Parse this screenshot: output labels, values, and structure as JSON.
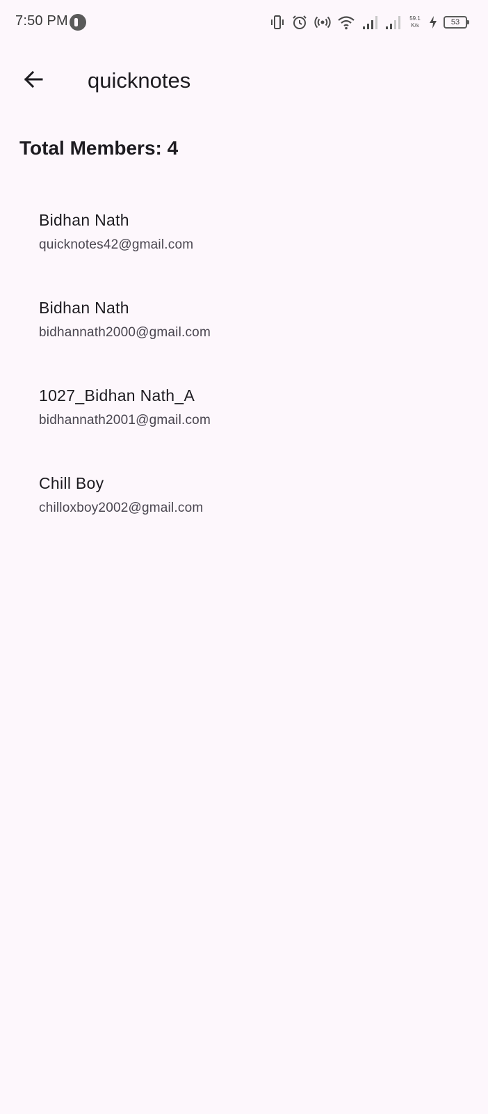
{
  "status_bar": {
    "time": "7:50 PM",
    "net_speed_value": "59.1",
    "net_speed_unit": "K/s",
    "battery_level": "53",
    "icons": [
      "app-notification-icon",
      "vibrate-icon",
      "alarm-icon",
      "hotspot-icon",
      "wifi-icon",
      "signal-icon",
      "signal-icon-2",
      "charging-icon",
      "battery-icon"
    ]
  },
  "app_bar": {
    "back_icon": "arrow-back-icon",
    "title": "quicknotes"
  },
  "summary": {
    "total_members": "Total Members: 4"
  },
  "members": [
    {
      "name": "Bidhan Nath",
      "email": "quicknotes42@gmail.com"
    },
    {
      "name": "Bidhan Nath",
      "email": "bidhannath2000@gmail.com"
    },
    {
      "name": "1027_Bidhan Nath_A",
      "email": "bidhannath2001@gmail.com"
    },
    {
      "name": "Chill Boy",
      "email": "chilloxboy2002@gmail.com"
    }
  ],
  "colors": {
    "background": "#fdf7fc",
    "text_primary": "#1d1b20",
    "text_secondary": "#49454f"
  }
}
